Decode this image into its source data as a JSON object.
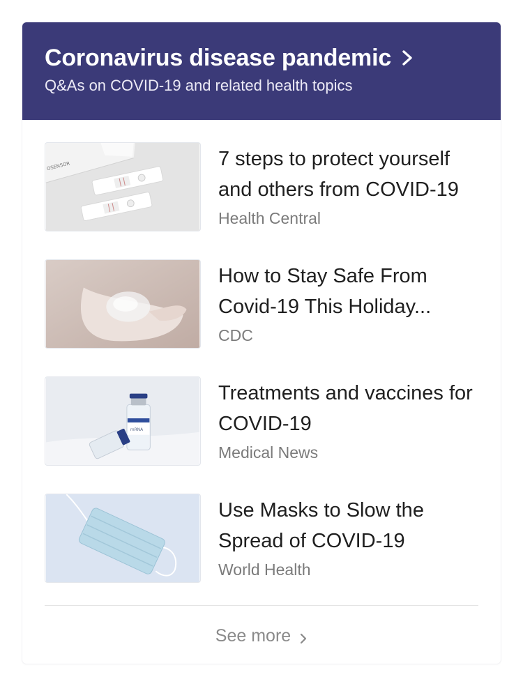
{
  "header": {
    "title": "Coronavirus disease pandemic",
    "subtitle": "Q&As on COVID-19 and related health topics",
    "color": "#3b3a78"
  },
  "items": [
    {
      "title": "7 steps to protect yourself and others from COVID-19",
      "source": "Health Central",
      "image": "test-kit-image"
    },
    {
      "title": "How to Stay Safe From Covid-19 This Holiday...",
      "source": "CDC",
      "image": "hand-sanitizer-image"
    },
    {
      "title": "Treatments and vaccines for COVID-19",
      "source": "Medical News",
      "image": "vaccine-vials-image"
    },
    {
      "title": "Use Masks to Slow the Spread of COVID-19",
      "source": "World Health",
      "image": "face-mask-image"
    }
  ],
  "footer": {
    "see_more_label": "See more"
  }
}
